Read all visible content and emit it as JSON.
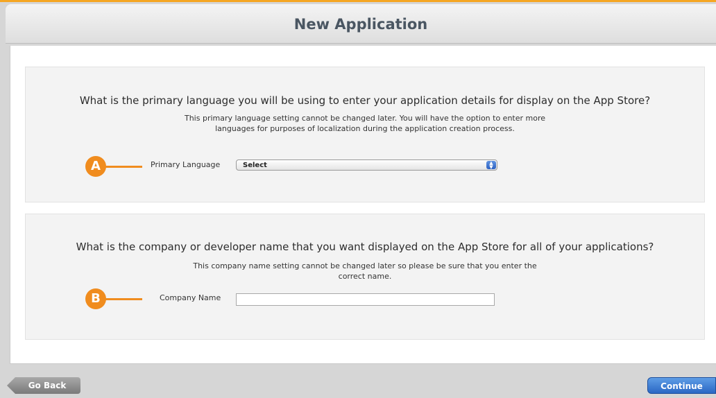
{
  "header": {
    "title": "New Application"
  },
  "language_section": {
    "marker": "A",
    "question": "What is the primary language you will be using to enter your application details for display on the App Store?",
    "note": "This primary language setting cannot be changed later. You will have the option to enter more languages for purposes of localization during the application creation process.",
    "field_label": "Primary Language",
    "select_value": "Select"
  },
  "company_section": {
    "marker": "B",
    "question": "What is the company or developer name that you want displayed on the App Store for all of your applications?",
    "note": "This company name setting cannot be changed later so please be sure that you enter the correct name.",
    "field_label": "Company Name",
    "input_value": ""
  },
  "footer": {
    "back_label": "Go Back",
    "continue_label": "Continue"
  },
  "colors": {
    "accent": "#f08c1e",
    "primary_button": "#2a67c4"
  },
  "icons": {
    "select_arrow": "up-down-arrows-icon",
    "back_arrow": "left-arrow-shape"
  }
}
